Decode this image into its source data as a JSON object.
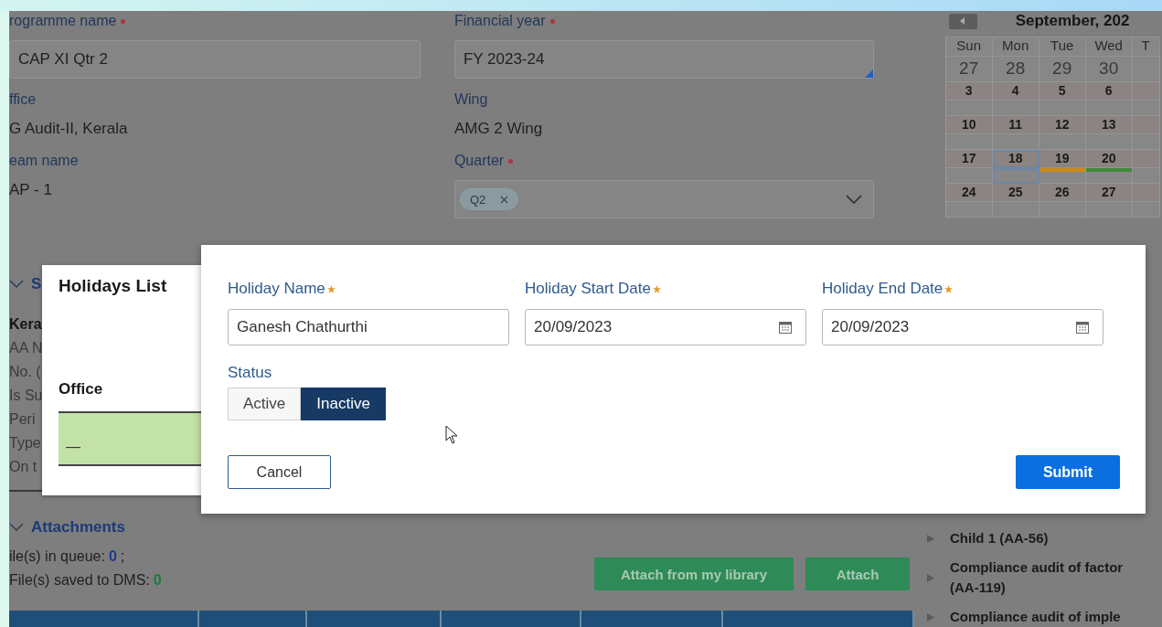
{
  "form": {
    "columns": [
      {
        "fields": [
          {
            "label": "rogramme name",
            "required": true,
            "kind": "input",
            "value": "CAP XI Qtr 2"
          },
          {
            "label": "ffice",
            "kind": "text",
            "value": "G Audit-II, Kerala"
          },
          {
            "label": "eam name",
            "kind": "text",
            "value": "AP - 1"
          }
        ]
      },
      {
        "fields": [
          {
            "label": "Financial year",
            "required": true,
            "kind": "input",
            "value": "FY 2023-24"
          },
          {
            "label": "Wing",
            "kind": "text",
            "value": "AMG 2 Wing"
          },
          {
            "label": "Quarter",
            "required": true,
            "kind": "multiselect",
            "chips": [
              "Q2"
            ]
          }
        ]
      }
    ]
  },
  "calendar": {
    "title": "September, 202",
    "weekdays": [
      "Sun",
      "Mon",
      "Tue",
      "Wed",
      "T"
    ],
    "weeks": [
      {
        "days": [
          {
            "day": "27",
            "other_month": true
          },
          {
            "day": "28",
            "other_month": true
          },
          {
            "day": "29",
            "other_month": true
          },
          {
            "day": "30",
            "other_month": true
          }
        ]
      },
      {
        "days": [
          {
            "day": "3"
          },
          {
            "day": "4"
          },
          {
            "day": "5"
          },
          {
            "day": "6"
          }
        ]
      },
      {
        "days": [
          {
            "day": "10"
          },
          {
            "day": "11"
          },
          {
            "day": "12"
          },
          {
            "day": "13"
          }
        ]
      },
      {
        "days": [
          {
            "day": "17"
          },
          {
            "day": "18",
            "today": true
          },
          {
            "day": "19",
            "color": "#c98a16"
          },
          {
            "day": "20",
            "color": "#3f8a3a"
          }
        ]
      },
      {
        "days": [
          {
            "day": "24"
          },
          {
            "day": "25"
          },
          {
            "day": "26"
          },
          {
            "day": "27"
          }
        ]
      }
    ]
  },
  "section": {
    "title": "S",
    "expanded": true,
    "lines": [
      {
        "text": "Kera",
        "kind": "heading"
      },
      {
        "text": "AA N",
        "kind": "text"
      },
      {
        "text": "No. (",
        "kind": "text"
      },
      {
        "text": "Is Su",
        "kind": "text"
      },
      {
        "text": "Peri",
        "kind": "text"
      },
      {
        "text": "Type",
        "kind": "text"
      },
      {
        "text": "On t",
        "kind": "text"
      }
    ]
  },
  "attachments": {
    "title": "Attachments",
    "expanded": true,
    "counters": [
      {
        "label": "ile(s) in queue:",
        "count": "0",
        "suffix": ";",
        "color": "#1d3d8c"
      },
      {
        "label": "File(s) saved to DMS:",
        "count": "0",
        "color": "#1f7a3c"
      }
    ],
    "buttons": [
      "Attach from my library",
      "Attach"
    ]
  },
  "tree": [
    {
      "lines": [
        "Child 1 (AA-56)"
      ],
      "expanded": false
    },
    {
      "lines": [
        "Compliance audit of factor",
        "(AA-119)"
      ],
      "expanded": false
    },
    {
      "lines": [
        "Compliance audit of imple"
      ],
      "expanded": false
    }
  ],
  "holidays_list": {
    "title": "Holidays List",
    "columns": [
      "Office"
    ],
    "rows": [
      {
        "cells": [
          "—"
        ],
        "selected": true
      }
    ]
  },
  "holiday_form": {
    "fields": [
      {
        "label": "Holiday Name",
        "required": true,
        "kind": "text",
        "value": "Ganesh Chathurthi"
      },
      {
        "label": "Holiday Start Date",
        "required": true,
        "kind": "date",
        "value": "20/09/2023"
      },
      {
        "label": "Holiday End Date",
        "required": true,
        "kind": "date",
        "value": "20/09/2023"
      }
    ],
    "status": {
      "label": "Status",
      "options": [
        {
          "label": "Active",
          "selected": false
        },
        {
          "label": "Inactive",
          "selected": true
        }
      ]
    },
    "buttons": [
      {
        "label": "Cancel",
        "kind": "secondary"
      },
      {
        "label": "Submit",
        "kind": "primary"
      }
    ]
  }
}
